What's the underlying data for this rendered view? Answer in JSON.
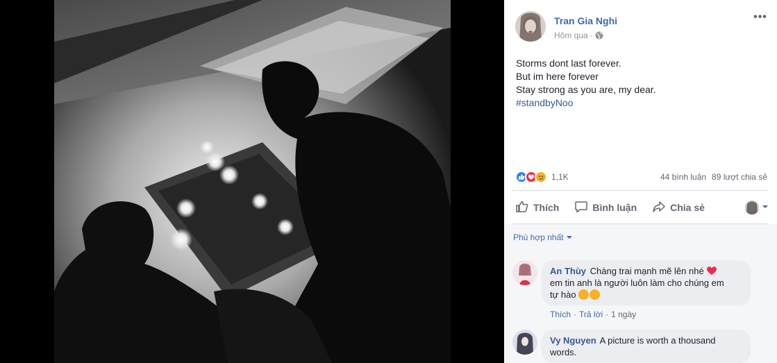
{
  "post": {
    "author": "Tran Gia Nghi",
    "time": "Hôm qua",
    "time_sep": "·",
    "more": "•••",
    "lines": [
      "Storms dont last forever.",
      "But im here forever",
      "Stay strong as you are, my dear."
    ],
    "hashtag": "#standbyNoo",
    "visibility_icon": "globe-icon"
  },
  "reactions": {
    "types": [
      "like",
      "love",
      "sad"
    ],
    "count": "1,1K",
    "comments": "44 bình luận",
    "shares": "89 lượt chia sẻ",
    "colors": {
      "like": "#2e81f4",
      "love": "#f0284a",
      "sad": "#f7b125"
    }
  },
  "actions": {
    "like": "Thích",
    "comment": "Bình luận",
    "share": "Chia sẻ"
  },
  "comments_header": {
    "sort_label": "Phù hợp nhất"
  },
  "comments": [
    {
      "name": "An Thùy",
      "text_line1": "Chàng trai mạnh mẽ lên nhé",
      "text_line2": "em tin anh là người luôn làm cho chúng em",
      "text_line3": "tự hào",
      "like": "Thích",
      "reply": "Trả lời",
      "time": "1 ngày",
      "sep": "·"
    },
    {
      "name": "Vy Nguyen",
      "text_line1": "A picture is worth a thousand",
      "text_line2": "words."
    }
  ],
  "colors": {
    "link": "#4267b2",
    "name": "#385898",
    "muted": "#606770"
  }
}
